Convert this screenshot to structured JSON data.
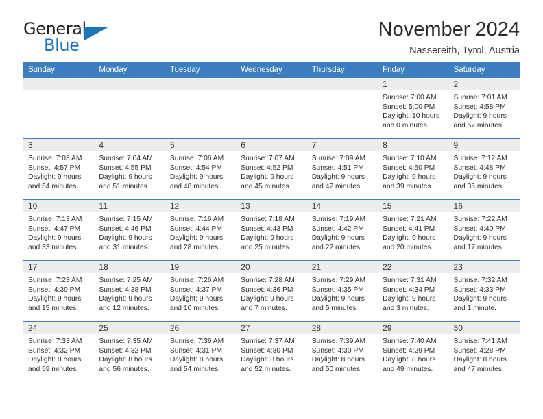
{
  "brand": {
    "name_top": "General",
    "name_bottom": "Blue",
    "accent_color": "#1b75bb",
    "logo_icon": "triangle-flag-icon"
  },
  "header": {
    "title": "November 2024",
    "subtitle": "Nassereith, Tyrol, Austria"
  },
  "calendar": {
    "header_bg": "#3b7ebf",
    "daynum_bg": "#ededed",
    "weekdays": [
      "Sunday",
      "Monday",
      "Tuesday",
      "Wednesday",
      "Thursday",
      "Friday",
      "Saturday"
    ],
    "weeks": [
      [
        {
          "day": ""
        },
        {
          "day": ""
        },
        {
          "day": ""
        },
        {
          "day": ""
        },
        {
          "day": ""
        },
        {
          "day": "1",
          "sunrise": "Sunrise: 7:00 AM",
          "sunset": "Sunset: 5:00 PM",
          "daylight1": "Daylight: 10 hours",
          "daylight2": "and 0 minutes."
        },
        {
          "day": "2",
          "sunrise": "Sunrise: 7:01 AM",
          "sunset": "Sunset: 4:58 PM",
          "daylight1": "Daylight: 9 hours",
          "daylight2": "and 57 minutes."
        }
      ],
      [
        {
          "day": "3",
          "sunrise": "Sunrise: 7:03 AM",
          "sunset": "Sunset: 4:57 PM",
          "daylight1": "Daylight: 9 hours",
          "daylight2": "and 54 minutes."
        },
        {
          "day": "4",
          "sunrise": "Sunrise: 7:04 AM",
          "sunset": "Sunset: 4:55 PM",
          "daylight1": "Daylight: 9 hours",
          "daylight2": "and 51 minutes."
        },
        {
          "day": "5",
          "sunrise": "Sunrise: 7:06 AM",
          "sunset": "Sunset: 4:54 PM",
          "daylight1": "Daylight: 9 hours",
          "daylight2": "and 48 minutes."
        },
        {
          "day": "6",
          "sunrise": "Sunrise: 7:07 AM",
          "sunset": "Sunset: 4:52 PM",
          "daylight1": "Daylight: 9 hours",
          "daylight2": "and 45 minutes."
        },
        {
          "day": "7",
          "sunrise": "Sunrise: 7:09 AM",
          "sunset": "Sunset: 4:51 PM",
          "daylight1": "Daylight: 9 hours",
          "daylight2": "and 42 minutes."
        },
        {
          "day": "8",
          "sunrise": "Sunrise: 7:10 AM",
          "sunset": "Sunset: 4:50 PM",
          "daylight1": "Daylight: 9 hours",
          "daylight2": "and 39 minutes."
        },
        {
          "day": "9",
          "sunrise": "Sunrise: 7:12 AM",
          "sunset": "Sunset: 4:48 PM",
          "daylight1": "Daylight: 9 hours",
          "daylight2": "and 36 minutes."
        }
      ],
      [
        {
          "day": "10",
          "sunrise": "Sunrise: 7:13 AM",
          "sunset": "Sunset: 4:47 PM",
          "daylight1": "Daylight: 9 hours",
          "daylight2": "and 33 minutes."
        },
        {
          "day": "11",
          "sunrise": "Sunrise: 7:15 AM",
          "sunset": "Sunset: 4:46 PM",
          "daylight1": "Daylight: 9 hours",
          "daylight2": "and 31 minutes."
        },
        {
          "day": "12",
          "sunrise": "Sunrise: 7:16 AM",
          "sunset": "Sunset: 4:44 PM",
          "daylight1": "Daylight: 9 hours",
          "daylight2": "and 28 minutes."
        },
        {
          "day": "13",
          "sunrise": "Sunrise: 7:18 AM",
          "sunset": "Sunset: 4:43 PM",
          "daylight1": "Daylight: 9 hours",
          "daylight2": "and 25 minutes."
        },
        {
          "day": "14",
          "sunrise": "Sunrise: 7:19 AM",
          "sunset": "Sunset: 4:42 PM",
          "daylight1": "Daylight: 9 hours",
          "daylight2": "and 22 minutes."
        },
        {
          "day": "15",
          "sunrise": "Sunrise: 7:21 AM",
          "sunset": "Sunset: 4:41 PM",
          "daylight1": "Daylight: 9 hours",
          "daylight2": "and 20 minutes."
        },
        {
          "day": "16",
          "sunrise": "Sunrise: 7:22 AM",
          "sunset": "Sunset: 4:40 PM",
          "daylight1": "Daylight: 9 hours",
          "daylight2": "and 17 minutes."
        }
      ],
      [
        {
          "day": "17",
          "sunrise": "Sunrise: 7:23 AM",
          "sunset": "Sunset: 4:39 PM",
          "daylight1": "Daylight: 9 hours",
          "daylight2": "and 15 minutes."
        },
        {
          "day": "18",
          "sunrise": "Sunrise: 7:25 AM",
          "sunset": "Sunset: 4:38 PM",
          "daylight1": "Daylight: 9 hours",
          "daylight2": "and 12 minutes."
        },
        {
          "day": "19",
          "sunrise": "Sunrise: 7:26 AM",
          "sunset": "Sunset: 4:37 PM",
          "daylight1": "Daylight: 9 hours",
          "daylight2": "and 10 minutes."
        },
        {
          "day": "20",
          "sunrise": "Sunrise: 7:28 AM",
          "sunset": "Sunset: 4:36 PM",
          "daylight1": "Daylight: 9 hours",
          "daylight2": "and 7 minutes."
        },
        {
          "day": "21",
          "sunrise": "Sunrise: 7:29 AM",
          "sunset": "Sunset: 4:35 PM",
          "daylight1": "Daylight: 9 hours",
          "daylight2": "and 5 minutes."
        },
        {
          "day": "22",
          "sunrise": "Sunrise: 7:31 AM",
          "sunset": "Sunset: 4:34 PM",
          "daylight1": "Daylight: 9 hours",
          "daylight2": "and 3 minutes."
        },
        {
          "day": "23",
          "sunrise": "Sunrise: 7:32 AM",
          "sunset": "Sunset: 4:33 PM",
          "daylight1": "Daylight: 9 hours",
          "daylight2": "and 1 minute."
        }
      ],
      [
        {
          "day": "24",
          "sunrise": "Sunrise: 7:33 AM",
          "sunset": "Sunset: 4:32 PM",
          "daylight1": "Daylight: 8 hours",
          "daylight2": "and 59 minutes."
        },
        {
          "day": "25",
          "sunrise": "Sunrise: 7:35 AM",
          "sunset": "Sunset: 4:32 PM",
          "daylight1": "Daylight: 8 hours",
          "daylight2": "and 56 minutes."
        },
        {
          "day": "26",
          "sunrise": "Sunrise: 7:36 AM",
          "sunset": "Sunset: 4:31 PM",
          "daylight1": "Daylight: 8 hours",
          "daylight2": "and 54 minutes."
        },
        {
          "day": "27",
          "sunrise": "Sunrise: 7:37 AM",
          "sunset": "Sunset: 4:30 PM",
          "daylight1": "Daylight: 8 hours",
          "daylight2": "and 52 minutes."
        },
        {
          "day": "28",
          "sunrise": "Sunrise: 7:39 AM",
          "sunset": "Sunset: 4:30 PM",
          "daylight1": "Daylight: 8 hours",
          "daylight2": "and 50 minutes."
        },
        {
          "day": "29",
          "sunrise": "Sunrise: 7:40 AM",
          "sunset": "Sunset: 4:29 PM",
          "daylight1": "Daylight: 8 hours",
          "daylight2": "and 49 minutes."
        },
        {
          "day": "30",
          "sunrise": "Sunrise: 7:41 AM",
          "sunset": "Sunset: 4:28 PM",
          "daylight1": "Daylight: 8 hours",
          "daylight2": "and 47 minutes."
        }
      ]
    ]
  }
}
